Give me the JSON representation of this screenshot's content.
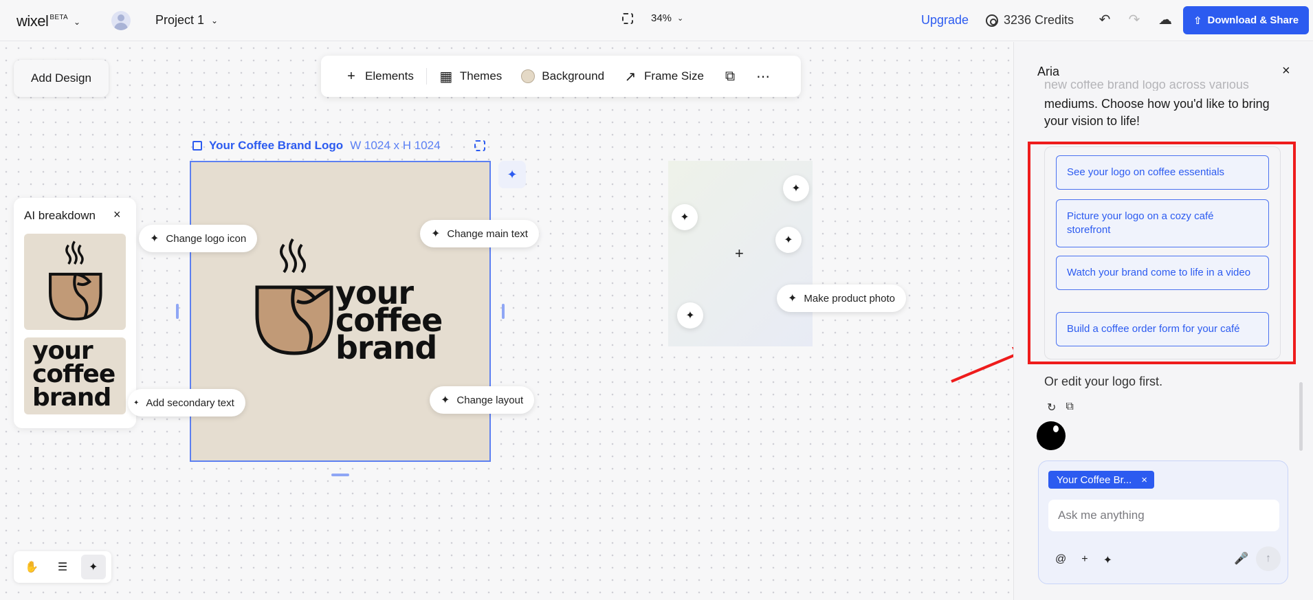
{
  "topbar": {
    "brand": "wixel",
    "brand_badge": "BETA",
    "project_name": "Project 1",
    "zoom": "34%",
    "upgrade": "Upgrade",
    "credits": "3236 Credits",
    "download_share": "Download & Share"
  },
  "canvas": {
    "add_design": "Add Design",
    "toolbar": {
      "elements": "Elements",
      "themes": "Themes",
      "background": "Background",
      "frame_size": "Frame Size"
    },
    "frame": {
      "name": "Your Coffee Brand Logo",
      "dimensions": "W 1024 x H 1024"
    },
    "logo_text": [
      "your",
      "coffee",
      "brand"
    ],
    "pills": {
      "change_logo_icon": "Change logo icon",
      "change_main_text": "Change main text",
      "add_secondary_text": "Add secondary text",
      "change_layout": "Change layout",
      "make_product_photo": "Make product photo"
    },
    "ai_breakdown": {
      "title": "AI breakdown",
      "thumb_text": [
        "your",
        "coffee",
        "brand"
      ]
    }
  },
  "panel": {
    "title": "Aria",
    "intro_faded": "new coffee brand logo across various",
    "intro": "mediums. Choose how you'd like to bring your vision to life!",
    "options": [
      "See your logo on coffee essentials",
      "Picture your logo on a cozy café storefront",
      "Watch your brand come to life in a video",
      "Build a coffee order form for your café"
    ],
    "edit_first": "Or edit your logo first.",
    "chip": "Your Coffee Br...",
    "ask_placeholder": "Ask me anything"
  },
  "colors": {
    "accent": "#2c5bf0",
    "artboard_bg": "#e5ddd0",
    "logo_fill": "#c19a77",
    "annotation_red": "#ee1c1c"
  }
}
